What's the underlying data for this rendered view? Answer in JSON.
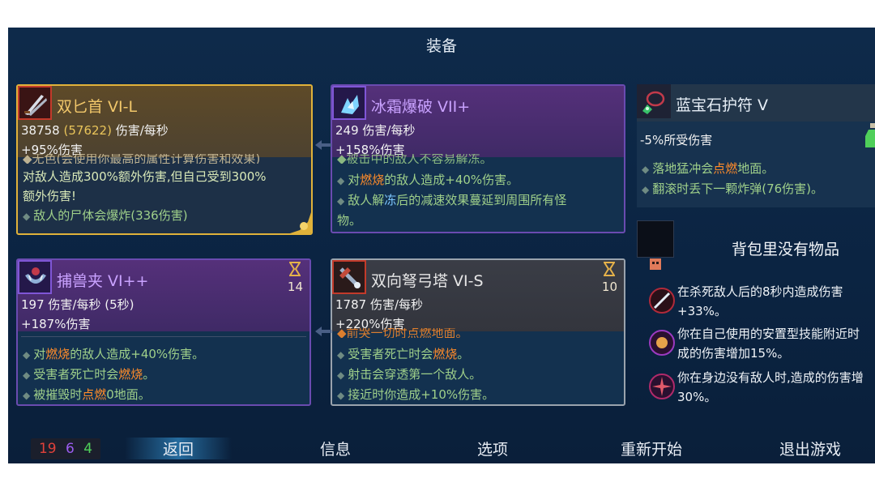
{
  "header": {
    "title": "装备"
  },
  "cards": {
    "dagger": {
      "name": "双匕首 VI-L",
      "dps": "38758",
      "dps_alt": "(57622)",
      "dps_unit": "伤害/每秒",
      "bonus": "+95%伤害",
      "cut_text": "◆无色(会使用你最高的属性计算伤害和效果)",
      "line1": "对敌人造成300%额外伤害,但自己受到300%",
      "line2": "额外伤害!",
      "line3": "敌人的尸体会爆炸(336伤害)"
    },
    "frost": {
      "name": "冰霜爆破 VII+",
      "dps": "249 伤害/每秒",
      "bonus": "+158%伤害",
      "cut_text": "◆被击中的敌人不容易解冻。",
      "line1_a": "对",
      "line1_fire": "燃烧",
      "line1_b": "的敌人造成+40%伤害。",
      "line2_a": "敌人解",
      "line2_ice": "冻",
      "line2_b": "后的减速效果蔓延到周围所有怪",
      "line3": "物。"
    },
    "trap": {
      "name": "捕兽夹 VI++",
      "dps": "197 伤害/每秒 (5秒)",
      "bonus": "+187%伤害",
      "timer": "14",
      "line1_a": "对",
      "line1_fire": "燃烧",
      "line1_b": "的敌人造成+40%伤害。",
      "line2_a": "受害者死亡时会",
      "line2_fire": "燃烧",
      "line2_b": "。",
      "line3_a": "被摧毁时",
      "line3_fire": "点燃",
      "line3_b": "0地面。"
    },
    "turret": {
      "name": "双向弩弓塔 VI-S",
      "dps": "1787 伤害/每秒",
      "bonus": "+220%伤害",
      "timer": "10",
      "cut_text": "◆前哭一切时点燃地面。",
      "line1_a": "受害者死亡时会",
      "line1_fire": "燃烧",
      "line1_b": "。",
      "line2": "射击会穿透第一个敌人。",
      "line3": "接近时你造成+10%伤害。"
    }
  },
  "amulet": {
    "name": "蓝宝石护符 V",
    "stat": "-5%所受伤害",
    "line1_a": "落地猛冲会",
    "line1_fire": "点燃",
    "line1_b": "地面。",
    "line2": "翻滚时丢下一颗炸弹(76伤害)。"
  },
  "backpack": {
    "empty": "背包里没有物品"
  },
  "mutations": [
    {
      "line1": "在杀死敌人后的8秒内造成伤害",
      "line2": "+33%。"
    },
    {
      "line1": "你在自己使用的安置型技能附近时",
      "line2": "成的伤害增加15%。"
    },
    {
      "line1": "你在身边没有敌人时,造成的伤害增",
      "line2": "30%。"
    }
  ],
  "stats": {
    "brutality": "19",
    "tactics": "6",
    "survival": "4",
    "colors": {
      "brutality": "#e0413a",
      "tactics": "#9b5cf0",
      "survival": "#4fcf5a"
    }
  },
  "menu": {
    "back": "返回",
    "info": "信息",
    "options": "选项",
    "restart": "重新开始",
    "quit": "退出游戏"
  }
}
